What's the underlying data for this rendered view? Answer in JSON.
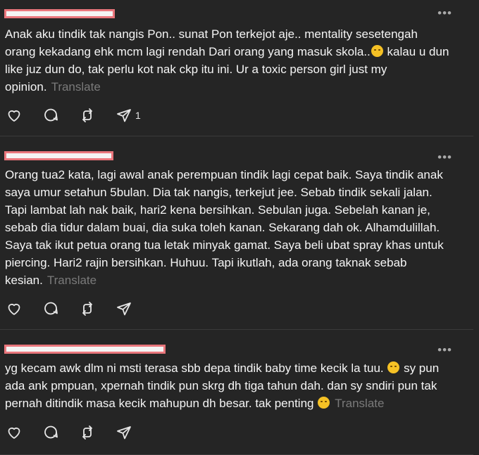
{
  "posts": [
    {
      "text": "Anak aku tindik tak nangis Pon.. sunat Pon terkejot aje.. mentality sesetengah orang kekadang ehk mcm lagi rendah Dari orang yang masuk skola..",
      "emoji": "rolling-on-floor-laughing",
      "text_after": " kalau u dun like juz dun do, tak perlu kot nak ckp itu ini. Ur a toxic person girl just my opinion.",
      "translate": "Translate",
      "share_count": "1"
    },
    {
      "text": "Orang tua2 kata, lagi awal anak perempuan tindik lagi cepat baik. Saya tindik anak saya umur setahun 5bulan. Dia tak nangis, terkejut jee. Sebab tindik sekali jalan. Tapi lambat lah nak baik, hari2 kena bersihkan. Sebulan juga. Sebelah kanan je, sebab dia tidur dalam buai, dia suka toleh kanan. Sekarang dah ok. Alhamdulillah. Saya tak ikut petua orang tua letak minyak gamat. Saya beli ubat spray khas untuk piercing. Hari2 rajin bersihkan. Huhuu. Tapi ikutlah, ada orang taknak sebab kesian.",
      "translate": "Translate",
      "share_count": ""
    },
    {
      "text": "yg kecam awk dlm ni msti terasa sbb depa tindik baby time kecik la tuu.",
      "emoji": "grinning-squinting-face",
      "text_after": " sy pun ada ank pmpuan, xpernah tindik pun skrg dh tiga tahun dah. dan sy sndiri pun tak pernah ditindik masa kecik mahupun dh besar. tak penting",
      "emoji2": "pensive-face",
      "translate": "Translate",
      "share_count": ""
    }
  ],
  "icons": {
    "like": "heart-icon",
    "reply": "comment-bubble-icon",
    "repost": "repost-icon",
    "share": "send-icon",
    "more": "more-options-icon"
  }
}
